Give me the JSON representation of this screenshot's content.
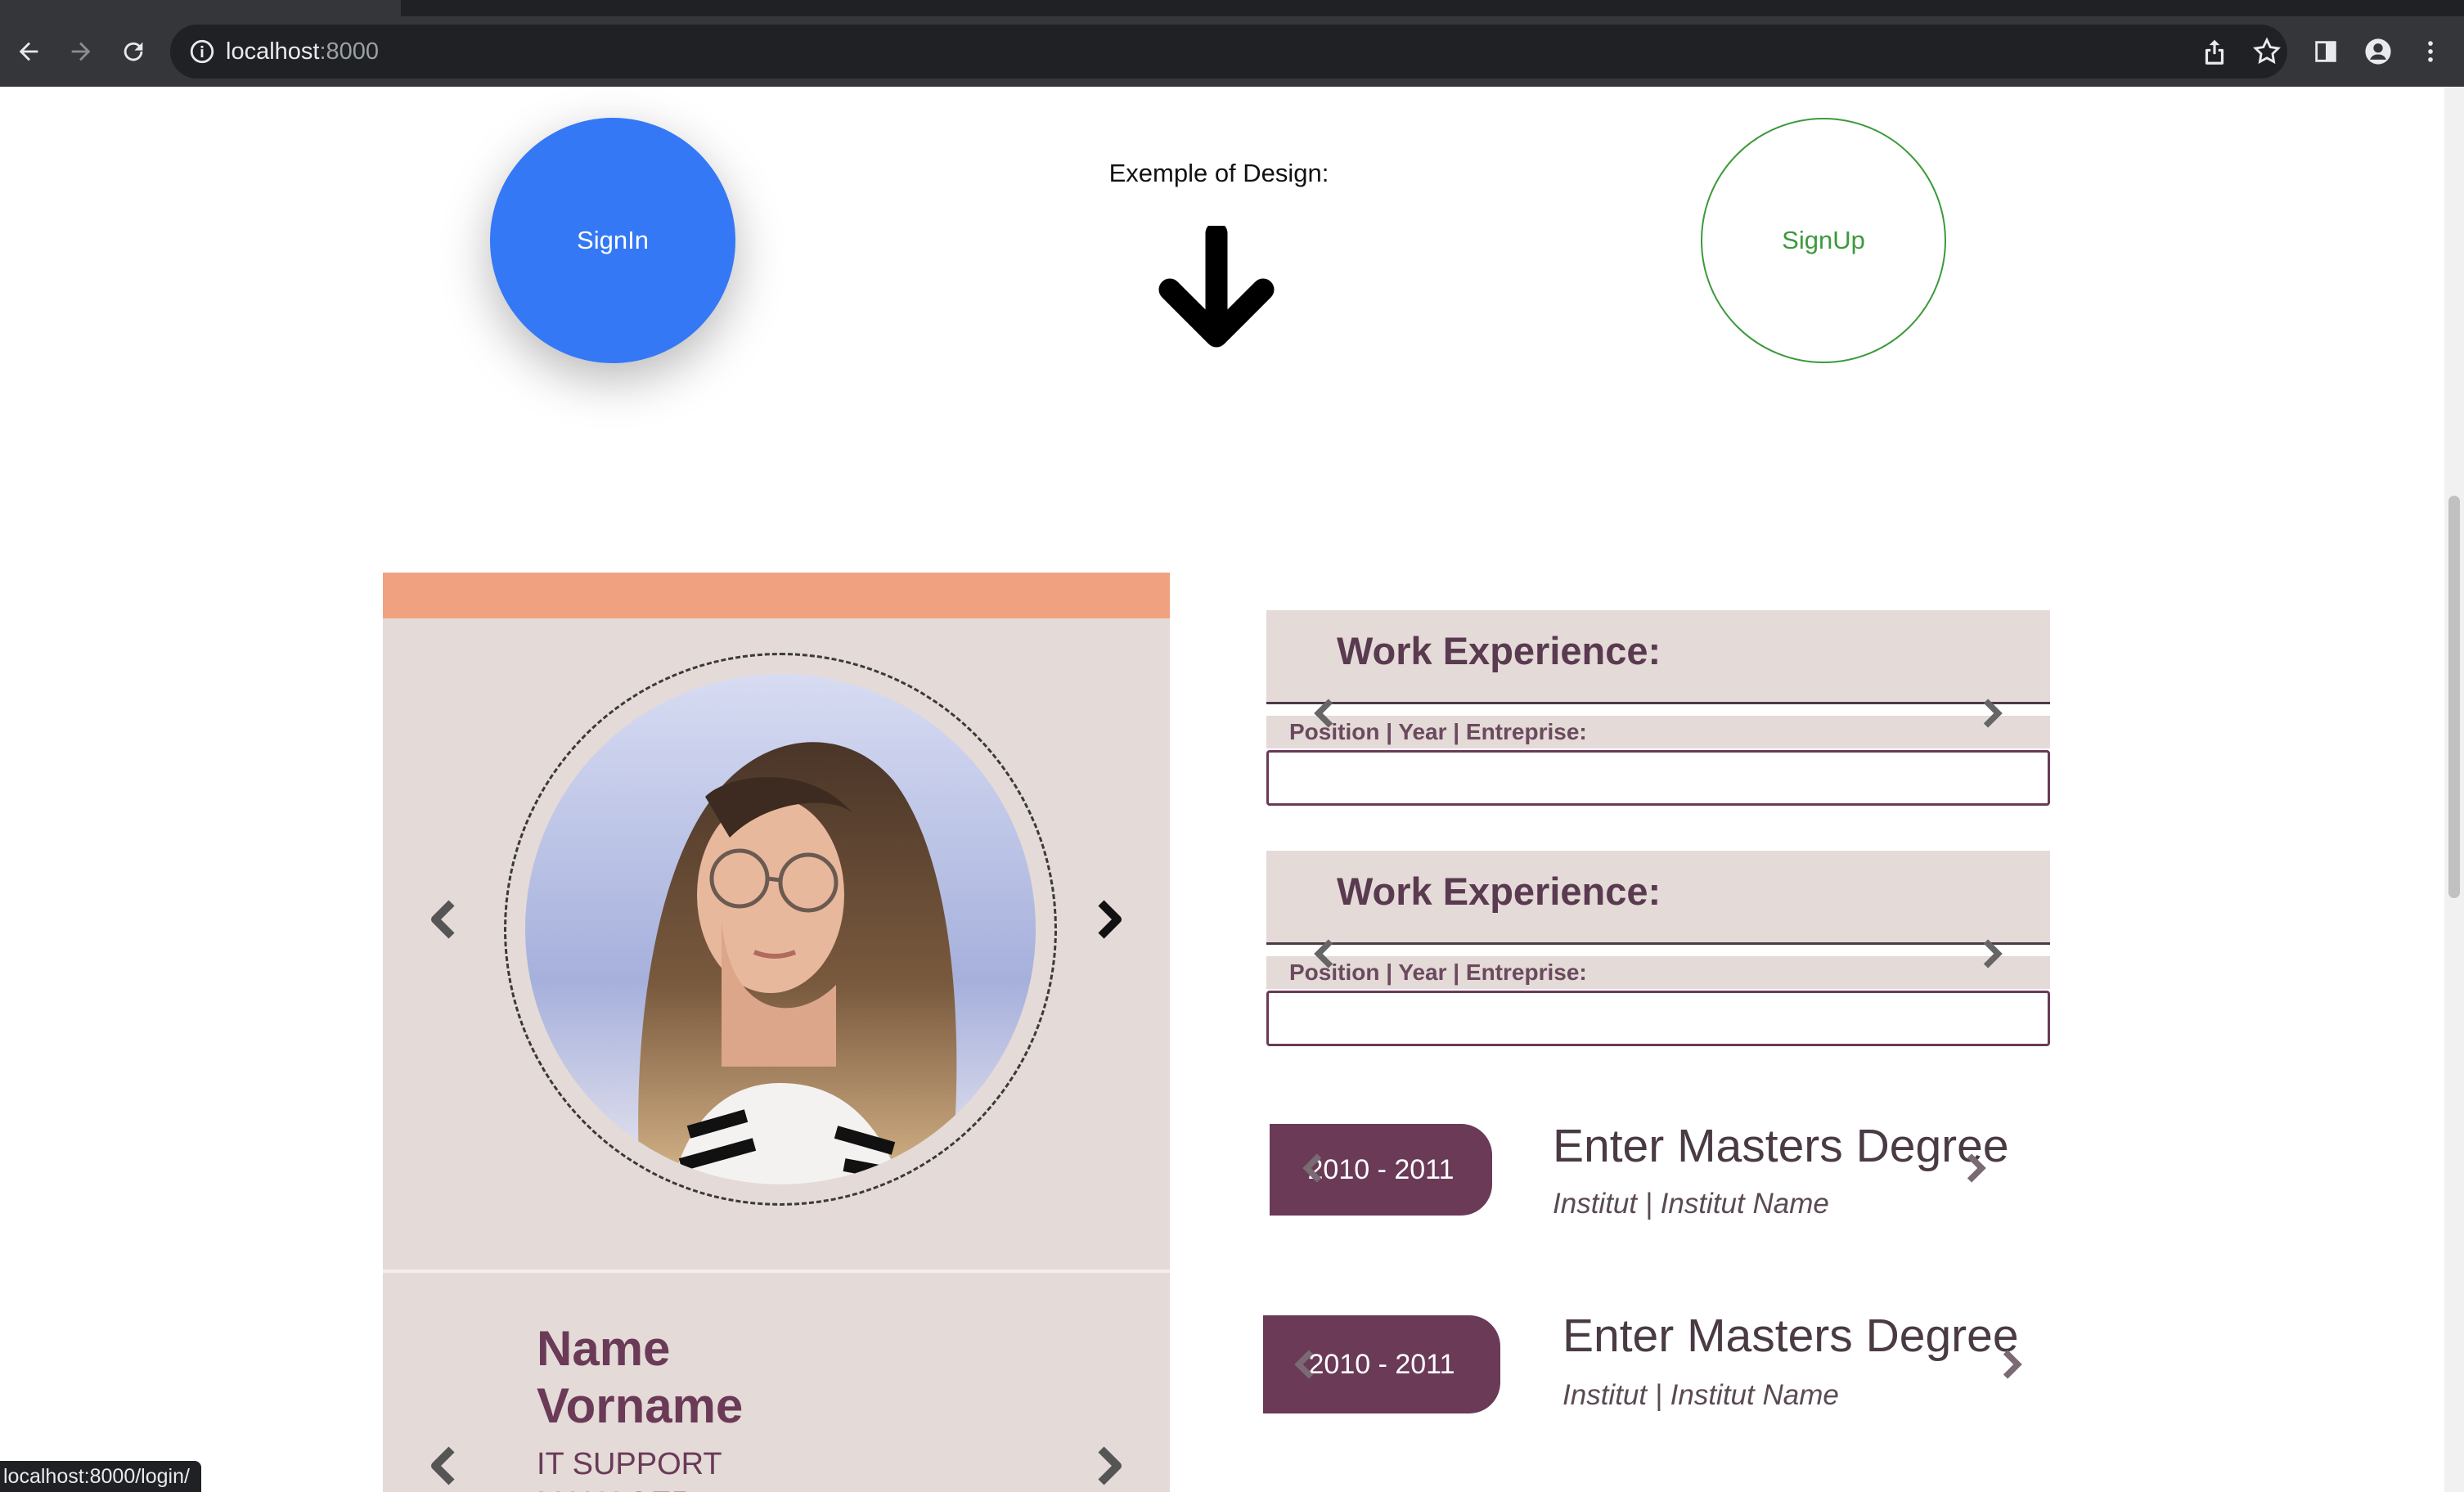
{
  "browser": {
    "url_host": "localhost",
    "url_port": ":8000",
    "status_url": "localhost:8000/login/"
  },
  "hero": {
    "signin_label": "SignIn",
    "signup_label": "SignUp",
    "design_label": "Exemple of Design:"
  },
  "cv": {
    "name_line1": "Name",
    "name_line2": "Vorname",
    "job_title": "IT SUPPORT",
    "job_title_2": "MANAGER"
  },
  "work": [
    {
      "title": "Work Experience:",
      "field_label": "Position | Year | Entreprise:",
      "value": ""
    },
    {
      "title": "Work Experience:",
      "field_label": "Position | Year | Entreprise:",
      "value": ""
    }
  ],
  "education": [
    {
      "years": "2010 - 2011",
      "degree": "Enter Masters Degree",
      "institution": "Institut | Institut Name"
    },
    {
      "years": "2010 - 2011",
      "degree": "Enter Masters Degree",
      "institution": "Institut | Institut Name"
    }
  ],
  "colors": {
    "signin_blue": "#3478f6",
    "signup_green": "#3c9a3c",
    "cv_accent": "#f0a17f",
    "cv_panel": "#e4dad7",
    "plum": "#6a3a57"
  }
}
